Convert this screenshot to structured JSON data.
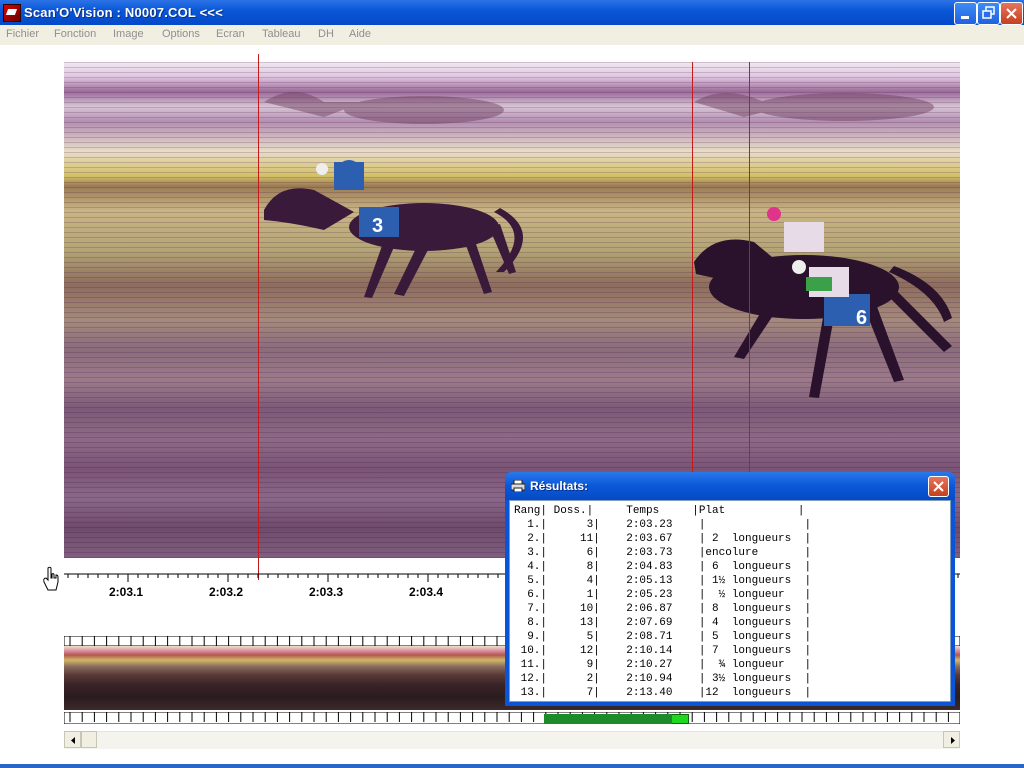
{
  "window": {
    "title": "Scan'O'Vision :  N0007.COL <<<",
    "icons": [
      "app-icon",
      "minimize-icon",
      "restore-icon",
      "close-icon"
    ]
  },
  "menu": [
    "Fichier",
    "Fonction",
    "Image",
    "Options",
    "Ecran",
    "Tableau",
    "DH",
    "Aide"
  ],
  "timeline": {
    "labels": [
      "2:03.1",
      "2:03.2",
      "2:03.3",
      "2:03.4"
    ]
  },
  "photo": {
    "numbers_on_saddle_cloths": [
      "3",
      "6"
    ]
  },
  "results": {
    "title": "Résultats:",
    "header": "Rang| Doss.|     Temps     |Plat           |",
    "rows": [
      "  1.|      3|    2:03.23    |               |",
      "  2.|     11|    2:03.67    | 2  longueurs  |",
      "  3.|      6|    2:03.73    |encolure       |",
      "  4.|      8|    2:04.83    | 6  longueurs  |",
      "  5.|      4|    2:05.13    | 1½ longueurs  |",
      "  6.|      1|    2:05.23    |  ½ longueur   |",
      "  7.|     10|    2:06.87    | 8  longueurs  |",
      "  8.|     13|    2:07.69    | 4  longueurs  |",
      "  9.|      5|    2:08.71    | 5  longueurs  |",
      " 10.|     12|    2:10.14    | 7  longueurs  |",
      " 11.|      9|    2:10.27    |  ¾ longueur   |",
      " 12.|      2|    2:10.94    | 3½ longueurs  |",
      " 13.|      7|    2:13.40    |12  longueurs  |"
    ]
  }
}
